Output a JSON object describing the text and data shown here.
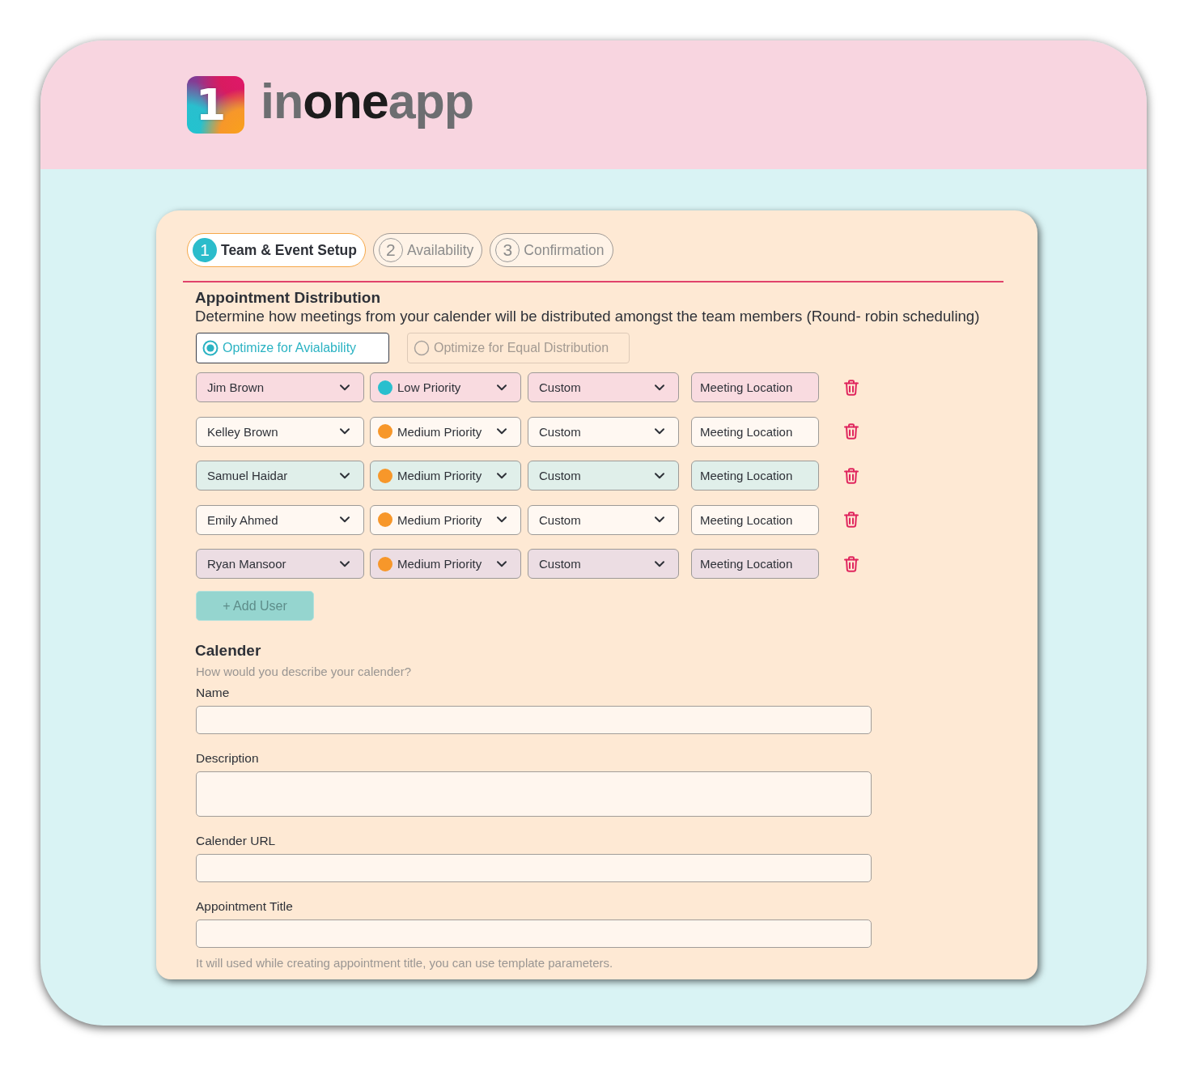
{
  "logo": {
    "mark": "1",
    "wordmark": "in**one**app"
  },
  "steps": [
    {
      "number": "1",
      "label": "Team & Event Setup",
      "selected": true
    },
    {
      "number": "2",
      "label": "Availability",
      "selected": false
    },
    {
      "number": "3",
      "label": "Confirmation",
      "selected": false
    }
  ],
  "distribution": {
    "title": "Appointment Distribution",
    "description": "Determine how meetings from your calender will be distributed amongst the team members (Round- robin scheduling)",
    "options": [
      {
        "label": "Optimize for Avialability",
        "selected": true
      },
      {
        "label": "Optimize for Equal Distribution",
        "selected": false
      }
    ]
  },
  "members": [
    {
      "name": "Jim Brown",
      "color": "#f9dbe0",
      "priority": {
        "label": "Low Priority",
        "color": "#29bfce"
      },
      "option": "Custom",
      "location": "Meeting Location"
    },
    {
      "name": "Kelley Brown",
      "color": "#fff8f2",
      "priority": {
        "label": "Medium Priority",
        "color": "#f7972a"
      },
      "option": "Custom",
      "location": "Meeting Location"
    },
    {
      "name": "Samuel Haidar",
      "color": "#e0efea",
      "priority": {
        "label": "Medium Priority",
        "color": "#f7972a"
      },
      "option": "Custom",
      "location": "Meeting Location"
    },
    {
      "name": "Emily Ahmed",
      "color": "#fff8f2",
      "priority": {
        "label": "Medium Priority",
        "color": "#f7972a"
      },
      "option": "Custom",
      "location": "Meeting Location"
    },
    {
      "name": "Ryan Mansoor",
      "color": "#ecdde3",
      "priority": {
        "label": "Medium Priority",
        "color": "#f7972a"
      },
      "option": "Custom",
      "location": "Meeting Location"
    }
  ],
  "add_button": "+ Add User",
  "calendar": {
    "title": "Calender",
    "hint": "How would you describe your calender?",
    "fields": [
      {
        "label": "Name",
        "kind": "input"
      },
      {
        "label": "Description",
        "kind": "textarea"
      },
      {
        "label": "Calender URL",
        "kind": "input"
      },
      {
        "label": "Appointment Title",
        "kind": "input"
      }
    ],
    "note": "It will used while creating appointment title, you can use template parameters."
  }
}
